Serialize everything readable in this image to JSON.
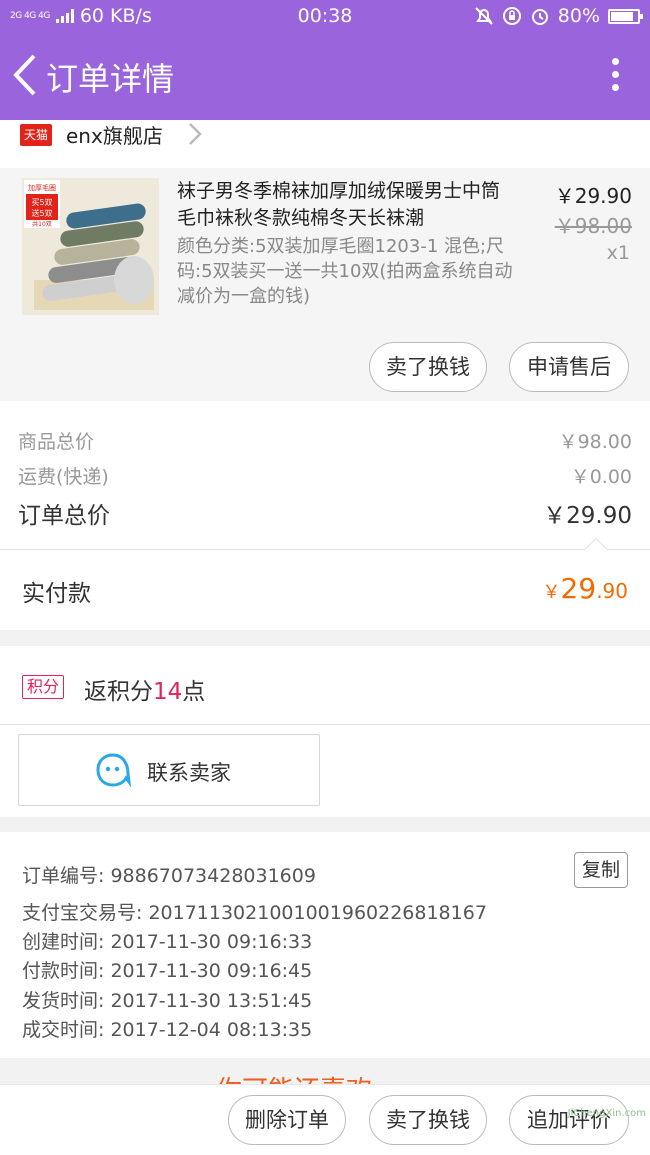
{
  "status_bar": {
    "signal": "2G 4G 4G",
    "speed": "60 KB/s",
    "time": "00:38",
    "battery": "80%"
  },
  "header": {
    "title": "订单详情"
  },
  "shop": {
    "badge": "天猫",
    "name": "enx旗舰店"
  },
  "item": {
    "title": "袜子男冬季棉袜加厚加绒保暖男士中筒毛巾袜秋冬款纯棉冬天长袜潮",
    "spec": "颜色分类:5双装加厚毛圈1203-1 混色;尺码:5双装买一送一共10双(拍两盒系统自动减价为一盒的钱)",
    "price": "￥29.90",
    "original_price": "￥98.00",
    "quantity": "x1",
    "thumb_badge_lines": [
      "加厚毛圈",
      "买5双",
      "送5双",
      "共10双"
    ],
    "buttons": {
      "exchange": "卖了换钱",
      "after_sale": "申请售后"
    }
  },
  "summary": {
    "goods_label": "商品总价",
    "goods_value": "￥98.00",
    "shipping_label": "运费(快递)",
    "shipping_value": "￥0.00",
    "total_label": "订单总价",
    "total_value": "￥29.90"
  },
  "paid": {
    "label": "实付款",
    "currency": "￥",
    "integer": "29",
    "decimal": ".90"
  },
  "points": {
    "tag": "积分",
    "prefix": "返积分",
    "number": "14",
    "suffix": "点"
  },
  "contact": {
    "label": "联系卖家"
  },
  "order_info": {
    "copy": "复制",
    "lines": [
      "订单编号: 98867073428031609",
      "支付宝交易号: 2017113021001001960226818167",
      "创建时间: 2017-11-30 09:16:33",
      "付款时间: 2017-11-30 09:16:45",
      "发货时间: 2017-11-30 13:51:45",
      "成交时间: 2017-12-04 08:13:35"
    ]
  },
  "recommend": {
    "title": "你可能还喜欢"
  },
  "bottom_bar": {
    "delete": "删除订单",
    "exchange": "卖了换钱",
    "review": "追加评价"
  },
  "watermark": "JiChengXin.com",
  "colors": {
    "brand_purple": "#9a64dc",
    "price_orange": "#f56a00",
    "points_red": "#e0245e",
    "tmall_red": "#e2231a"
  }
}
